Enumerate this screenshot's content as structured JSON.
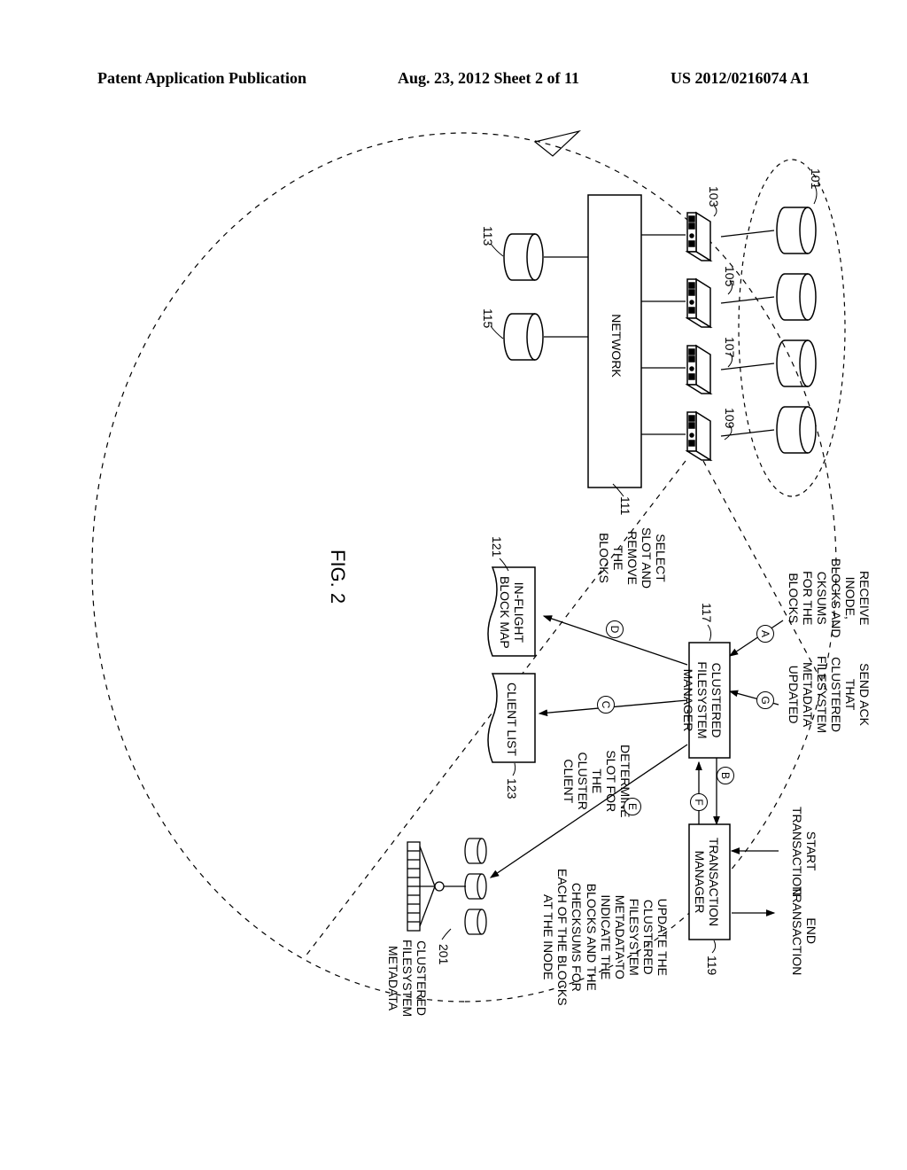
{
  "header": {
    "left": "Patent Application Publication",
    "center": "Aug. 23, 2012  Sheet 2 of 11",
    "right": "US 2012/0216074 A1"
  },
  "fig_label": "FIG. 2",
  "refs": {
    "r101": "101",
    "r103": "103",
    "r105": "105",
    "r107": "107",
    "r109": "109",
    "r111": "111",
    "r113": "113",
    "r115": "115",
    "r117": "117",
    "r119": "119",
    "r121": "121",
    "r123": "123",
    "r201": "201"
  },
  "labels": {
    "network": "NETWORK",
    "receive": "RECEIVE\nINODE,\nBLOCKS AND\nCKSUMS\nFOR THE\nBLOCKS",
    "send_ack": "SEND ACK\nTHAT\nCLUSTERED\nFILESYSTEM\nMETADATA\nUPDATED",
    "start_tx": "START\nTRANSACTION",
    "end_tx": "END\nTRANSACTION",
    "tx_mgr": "TRANSACTION\nMANAGER",
    "cfs_mgr": "CLUSTERED\nFILESYSTEM\nMANAGER",
    "select_slot": "SELECT\nSLOT AND\nREMOVE\nTHE\nBLOCKS",
    "inflight": "IN-FLIGHT\nBLOCK MAP",
    "client_list": "CLIENT LIST",
    "determine_slot": "DETERMINE\nSLOT FOR\nTHE\nCLUSTER\nCLIENT",
    "update_meta": "UPDATE THE\nCLUSTERED\nFILESYSTEM\nMETADATA TO\nINDICATE THE\nBLOCKS AND THE\nCHECKSUMS FOR\nEACH OF THE BLOCKS\nAT THE INODE",
    "cfs_meta": "CLUSTERED\nFILESYSTEM\nMETADATA"
  },
  "circles": {
    "A": "A",
    "B": "B",
    "C": "C",
    "D": "D",
    "E": "E",
    "F": "F",
    "G": "G"
  }
}
